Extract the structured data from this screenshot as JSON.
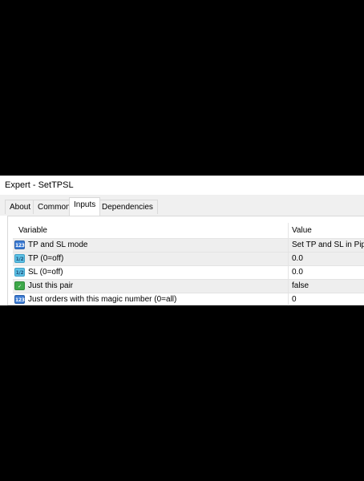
{
  "window": {
    "title": "Expert - SetTPSL"
  },
  "tabs": [
    {
      "label": "About",
      "active": false
    },
    {
      "label": "Common",
      "active": false
    },
    {
      "label": "Inputs",
      "active": true
    },
    {
      "label": "Dependencies",
      "active": false
    }
  ],
  "grid": {
    "headers": {
      "variable": "Variable",
      "value": "Value"
    },
    "rows": [
      {
        "icon": "integer-type-icon",
        "icon_text": "123",
        "variable": "TP and SL mode",
        "value": "Set TP and SL in Pips"
      },
      {
        "icon": "double-type-icon",
        "icon_text": "1/2",
        "variable": "TP (0=off)",
        "value": "0.0"
      },
      {
        "icon": "double-type-icon",
        "icon_text": "1/2",
        "variable": "SL (0=off)",
        "value": "0.0"
      },
      {
        "icon": "boolean-type-icon",
        "icon_text": "✓",
        "variable": "Just this pair",
        "value": "false"
      },
      {
        "icon": "integer-type-icon",
        "icon_text": "123",
        "variable": "Just orders with this magic number (0=all)",
        "value": "0"
      }
    ]
  }
}
